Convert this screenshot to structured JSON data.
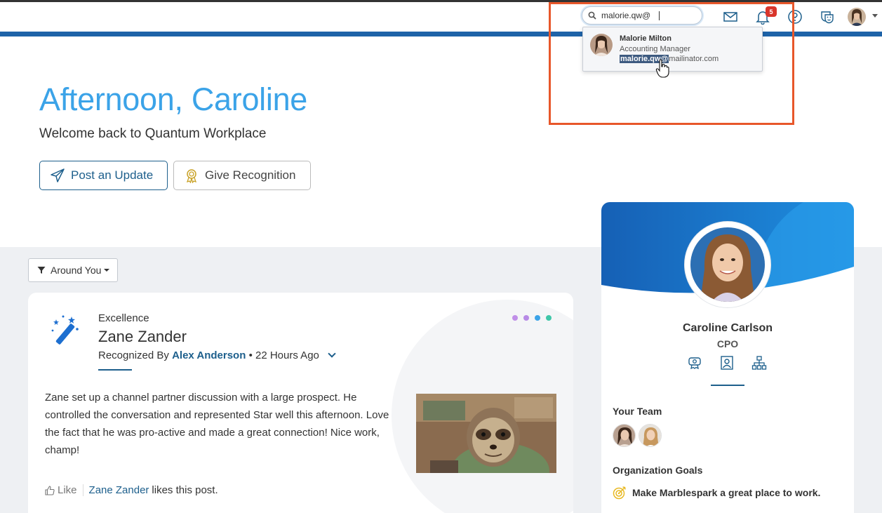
{
  "header": {
    "search_value": "malorie.qw@",
    "notification_count": "5",
    "icons": [
      "mail-icon",
      "bell-icon",
      "help-icon",
      "theater-masks-icon",
      "user-avatar"
    ]
  },
  "search_suggestion": {
    "name": "Malorie Milton",
    "role": "Accounting Manager",
    "email_match": "malorie.qw@",
    "email_rest": "mailinator.com"
  },
  "hero": {
    "greeting": "Afternoon, Caroline",
    "welcome": "Welcome back to Quantum Workplace",
    "post_update_label": "Post an Update",
    "give_recognition_label": "Give Recognition"
  },
  "feed": {
    "filter_label": "Around You",
    "post": {
      "category": "Excellence",
      "recipient": "Zane Zander",
      "recognized_by_prefix": "Recognized By",
      "author": "Alex Anderson",
      "time": "• 22 Hours Ago",
      "body": "Zane set up a channel partner discussion with a large prospect. He controlled the conversation and represented Star well this afternoon. Love the fact that he was pro-active and made a great connection! Nice work, champ!",
      "like_label": "Like",
      "liker": "Zane Zander",
      "likes_suffix": "likes this post.",
      "dot_colors": [
        "#c08fe8",
        "#b78ae6",
        "#3ba3e8",
        "#3fc6a8"
      ]
    }
  },
  "profile": {
    "name": "Caroline Carlson",
    "title": "CPO",
    "team_label": "Your Team",
    "goals_label": "Organization Goals",
    "goal": "Make Marblespark a great place to work."
  },
  "colors": {
    "brand_blue": "#1e63a8",
    "accent_light_blue": "#3ba3e8",
    "highlight_orange": "#e8572a",
    "badge_red": "#d9352b"
  }
}
